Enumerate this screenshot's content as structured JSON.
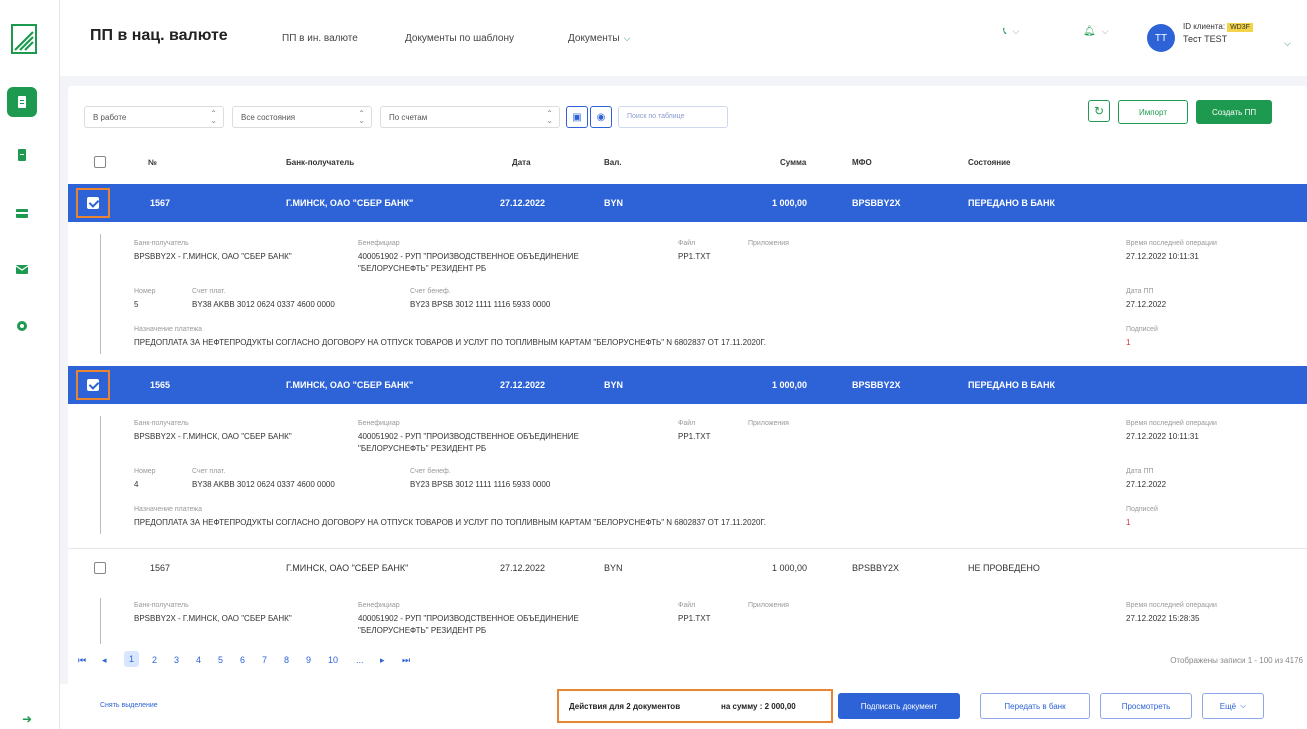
{
  "sidebar": {
    "icons": [
      "logo-icon",
      "document-icon",
      "file-icon",
      "card-icon",
      "mail-icon",
      "settings-icon",
      "exit-icon"
    ]
  },
  "header": {
    "title": "ПП в нац. валюте",
    "nav": [
      "ПП в ин. валюте",
      "Документы по шаблону",
      "Документы"
    ],
    "avatar": "ТТ",
    "client_label": "ID клиента:",
    "client_id": "WD3F",
    "client_name": "Тест TEST"
  },
  "filters": {
    "status": "В работе",
    "state": "Все состояния",
    "accounts": "По счетам",
    "search_placeholder": "Поиск по таблице"
  },
  "actions": {
    "import": "Импорт",
    "create": "Создать ПП"
  },
  "table": {
    "columns": [
      "№",
      "Банк-получатель",
      "Дата",
      "Вал.",
      "Сумма",
      "МФО",
      "Состояние"
    ],
    "rows": [
      {
        "num": "1567",
        "bank": "Г.МИНСК, ОАО \"СБЕР БАНК\"",
        "date": "27.12.2022",
        "cur": "BYN",
        "sum": "1 000,00",
        "mfo": "BPSBBY2X",
        "state": "ПЕРЕДАНО В БАНК"
      },
      {
        "num": "1565",
        "bank": "Г.МИНСК, ОАО \"СБЕР БАНК\"",
        "date": "27.12.2022",
        "cur": "BYN",
        "sum": "1 000,00",
        "mfo": "BPSBBY2X",
        "state": "ПЕРЕДАНО В БАНК"
      },
      {
        "num": "1567",
        "bank": "Г.МИНСК, ОАО \"СБЕР БАНК\"",
        "date": "27.12.2022",
        "cur": "BYN",
        "sum": "1 000,00",
        "mfo": "BPSBBY2X",
        "state": "НЕ ПРОВЕДЕНО"
      }
    ]
  },
  "details": [
    {
      "bank_label": "Банк-получатель",
      "bank": "BPSBBY2X - Г.МИНСК, ОАО \"СБЕР БАНК\"",
      "benef_label": "Бенефициар",
      "benef1": "400051902 - РУП \"ПРОИЗВОДСТВЕННОЕ ОБЪЕДИНЕНИЕ",
      "benef2": "\"БЕЛОРУСНЕФТЬ\" РЕЗИДЕНТ РБ",
      "file_label": "Файл",
      "file": "PP1.TXT",
      "attach_label": "Приложения",
      "last_op_label": "Время последней операции",
      "last_op": "27.12.2022 10:11:31",
      "num_label": "Номер",
      "num": "5",
      "payer_label": "Счет плат.",
      "payer": "BY38 AKBB 3012 0624 0337 4600 0000",
      "benacc_label": "Счет бенеф.",
      "benacc": "BY23 BPSB 3012 1111 1116 5933 0000",
      "date_label": "Дата ПП",
      "date": "27.12.2022",
      "purpose_label": "Назначение платежа",
      "purpose": "ПРЕДОПЛАТА ЗА НЕФТЕПРОДУКТЫ СОГЛАСНО ДОГОВОРУ НА ОТПУСК ТОВАРОВ И УСЛУГ ПО ТОПЛИВНЫМ КАРТАМ \"БЕЛОРУСНЕФТЬ\" N 6802837 ОТ 17.11.2020Г.",
      "sign_label": "Подписей",
      "sign": "1"
    },
    {
      "bank_label": "Банк-получатель",
      "bank": "BPSBBY2X - Г.МИНСК, ОАО \"СБЕР БАНК\"",
      "benef_label": "Бенефициар",
      "benef1": "400051902 - РУП \"ПРОИЗВОДСТВЕННОЕ ОБЪЕДИНЕНИЕ",
      "benef2": "\"БЕЛОРУСНЕФТЬ\" РЕЗИДЕНТ РБ",
      "file_label": "Файл",
      "file": "PP1.TXT",
      "attach_label": "Приложения",
      "last_op_label": "Время последней операции",
      "last_op": "27.12.2022 10:11:31",
      "num_label": "Номер",
      "num": "4",
      "payer_label": "Счет плат.",
      "payer": "BY38 AKBB 3012 0624 0337 4600 0000",
      "benacc_label": "Счет бенеф.",
      "benacc": "BY23 BPSB 3012 1111 1116 5933 0000",
      "date_label": "Дата ПП",
      "date": "27.12.2022",
      "purpose_label": "Назначение платежа",
      "purpose": "ПРЕДОПЛАТА ЗА НЕФТЕПРОДУКТЫ СОГЛАСНО ДОГОВОРУ НА ОТПУСК ТОВАРОВ И УСЛУГ ПО ТОПЛИВНЫМ КАРТАМ \"БЕЛОРУСНЕФТЬ\" N 6802837 ОТ 17.11.2020Г.",
      "sign_label": "Подписей",
      "sign": "1"
    },
    {
      "bank_label": "Банк-получатель",
      "bank": "BPSBBY2X - Г.МИНСК, ОАО \"СБЕР БАНК\"",
      "benef_label": "Бенефициар",
      "benef1": "400051902 - РУП \"ПРОИЗВОДСТВЕННОЕ ОБЪЕДИНЕНИЕ",
      "benef2": "\"БЕЛОРУСНЕФТЬ\" РЕЗИДЕНТ РБ",
      "file_label": "Файл",
      "file": "PP1.TXT",
      "attach_label": "Приложения",
      "last_op_label": "Время последней операции",
      "last_op": "27.12.2022 15:28:35"
    }
  ],
  "pager": {
    "pages": [
      "1",
      "2",
      "3",
      "4",
      "5",
      "6",
      "7",
      "8",
      "9",
      "10",
      "..."
    ],
    "info": "Отображены записи 1 - 100 из 4176"
  },
  "bottom": {
    "clear": "Снять выделение",
    "docs": "Действия для 2 документов",
    "sum": "на сумму : 2 000,00",
    "sign": "Подписать документ",
    "send": "Передать в банк",
    "view": "Просмотреть",
    "more": "Ещё"
  },
  "colors": {
    "green": "#1e9a50",
    "blue": "#2d63d6",
    "orange": "#e88432"
  }
}
